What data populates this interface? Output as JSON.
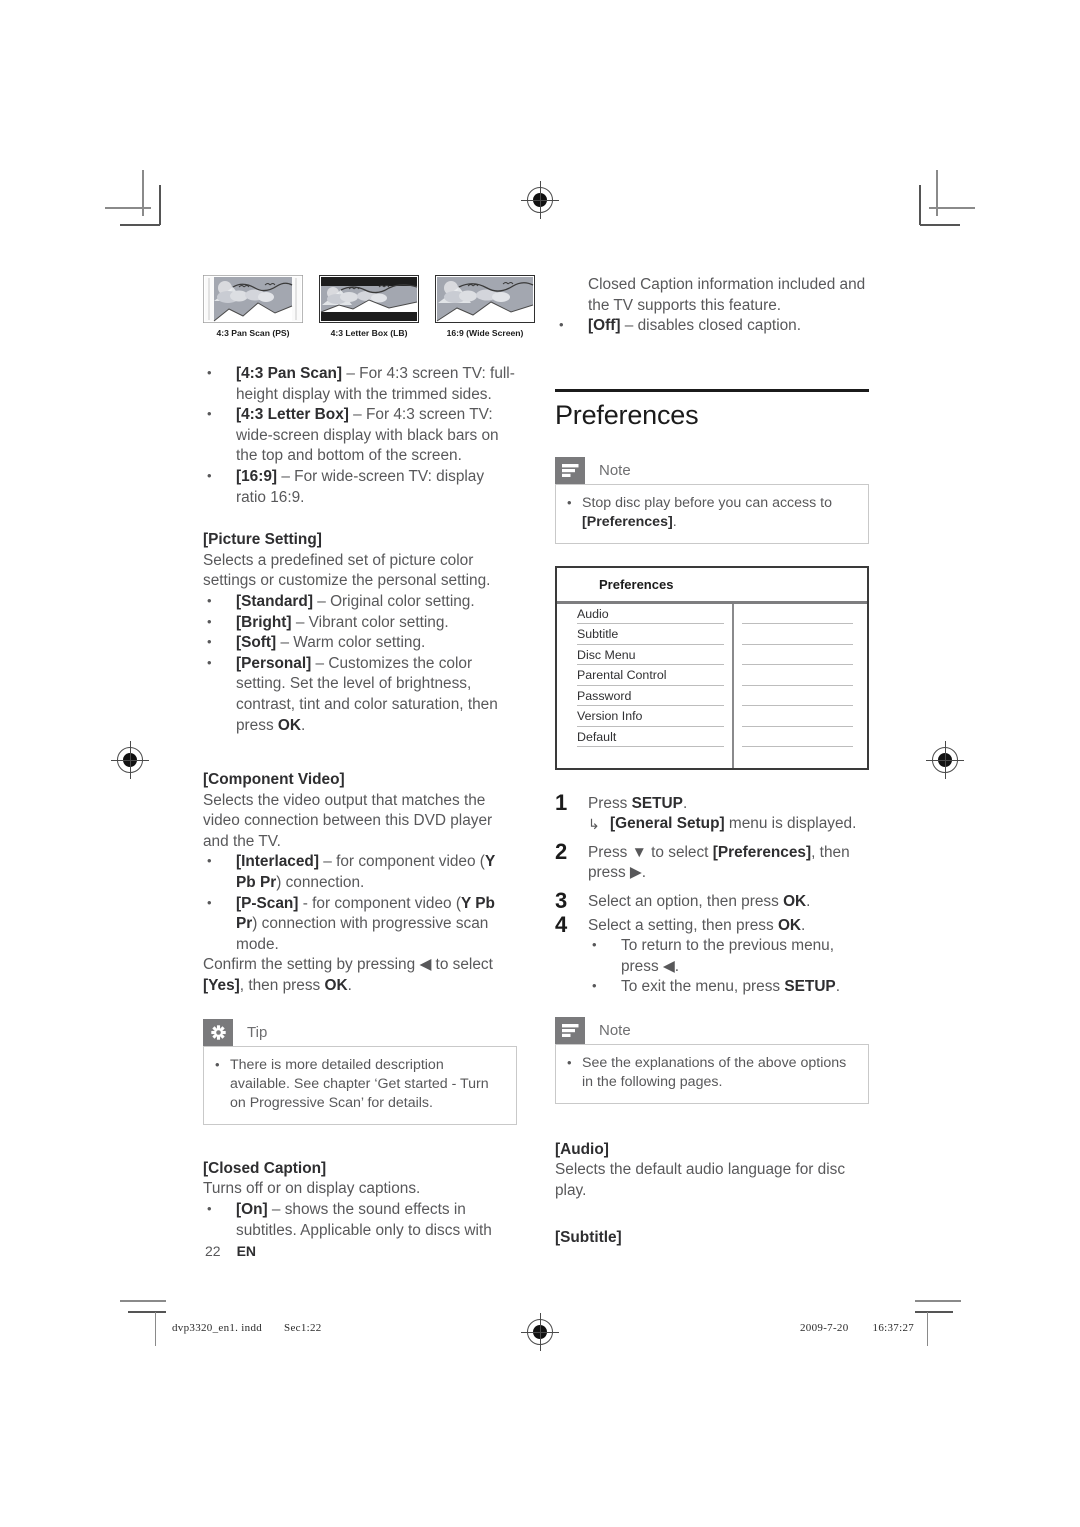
{
  "document": {
    "page_number": "22",
    "language_code": "EN",
    "footer_file": "dvp3320_en1. indd",
    "footer_section": "Sec1:22",
    "footer_date": "2009-7-20",
    "footer_time": "16:37:27"
  },
  "illustrations": {
    "captions": [
      "4:3 Pan Scan (PS)",
      "4:3 Letter Box (LB)",
      "16:9 (Wide Screen)"
    ]
  },
  "left_column": {
    "tv_format_bullets": [
      {
        "term": "[4:3 Pan Scan]",
        "rest": " – For 4:3 screen TV: full-height display with the trimmed sides."
      },
      {
        "term": "[4:3 Letter Box]",
        "rest": " – For 4:3 screen TV: wide-screen display with black bars on the top and bottom of the screen."
      },
      {
        "term": "[16:9]",
        "rest": " – For wide-screen TV: display ratio 16:9."
      }
    ],
    "picture_setting": {
      "heading": "[Picture Setting]",
      "intro": "Selects a predefined set of picture color settings or customize the personal setting.",
      "bullets": [
        {
          "term": "[Standard]",
          "rest": " – Original color setting."
        },
        {
          "term": "[Bright]",
          "rest": " – Vibrant color setting."
        },
        {
          "term": "[Soft]",
          "rest": " – Warm color setting."
        },
        {
          "term": "[Personal]",
          "rest": " – Customizes the color setting. Set the level of brightness, contrast, tint and color saturation, then press ",
          "bold_tail": "OK",
          "tail": "."
        }
      ]
    },
    "component_video": {
      "heading": "[Component Video]",
      "intro": "Selects the video output that matches the video connection between this DVD player and the TV.",
      "bullet1_term": "[Interlaced]",
      "bullet1_mid": " – for component video (",
      "bullet1_bold": "Y Pb Pr",
      "bullet1_tail": ") connection.",
      "bullet2_term": "[P-Scan]",
      "bullet2_mid": " - for component video (",
      "bullet2_bold": "Y Pb Pr",
      "bullet2_tail": ") connection with progressive scan mode.",
      "confirm_a": "Confirm the setting by pressing ",
      "confirm_arrow": "◀",
      "confirm_b": " to select ",
      "confirm_yes": "[Yes]",
      "confirm_c": ", then press ",
      "confirm_ok": "OK",
      "confirm_d": "."
    },
    "tip": {
      "label": "Tip",
      "icon": "asterisk-icon",
      "bullet": "There is more detailed description available. See chapter ‘Get started - Turn on Progressive Scan’ for details."
    },
    "closed_caption": {
      "heading": "[Closed Caption]",
      "intro": "Turns off or on display captions.",
      "bullet_term": "[On]",
      "bullet_rest": " – shows the sound effects in subtitles. Applicable only to discs with"
    }
  },
  "right_column": {
    "continuation": "Closed Caption information included and the TV supports this feature.",
    "off_bullet_term": "[Off]",
    "off_bullet_rest": " – disables closed caption.",
    "section_title": "Preferences",
    "note_top": {
      "label": "Note",
      "icon": "note-lines-icon",
      "text_a": "Stop disc play before you can access to ",
      "text_bold": "[Preferences]",
      "text_b": "."
    },
    "prefs_menu": {
      "title": "Preferences",
      "rows": [
        "Audio",
        "Subtitle",
        "Disc Menu",
        "Parental Control",
        "Password",
        "Version Info",
        "Default"
      ]
    },
    "steps": [
      {
        "num": "1",
        "text_a": "Press ",
        "text_bold": "SETUP",
        "text_b": ".",
        "sub_arrow": "↳",
        "sub_bold": "[General Setup]",
        "sub_rest": " menu is displayed."
      },
      {
        "num": "2",
        "text_a": "Press ",
        "symbol1": "▼",
        "text_b": " to select ",
        "text_bold": "[Preferences]",
        "text_c": ", then press ",
        "symbol2": "▶",
        "text_d": "."
      },
      {
        "num": "3",
        "text_a": "Select an option, then press ",
        "text_bold": "OK",
        "text_b": "."
      },
      {
        "num": "4",
        "text_a": "Select a setting, then press ",
        "text_bold": "OK",
        "text_b": ".",
        "bullets": [
          {
            "a": "To return to the previous menu, press ",
            "sym": "◀",
            "b": "."
          },
          {
            "a": "To exit the menu, press ",
            "bold": "SETUP",
            "b": "."
          }
        ]
      }
    ],
    "note_bottom": {
      "label": "Note",
      "icon": "note-lines-icon",
      "text": "See the explanations of the above options in the following pages."
    },
    "audio": {
      "heading": "[Audio]",
      "text": "Selects the default audio language for disc play."
    },
    "subtitle": {
      "heading": "[Subtitle]"
    }
  }
}
